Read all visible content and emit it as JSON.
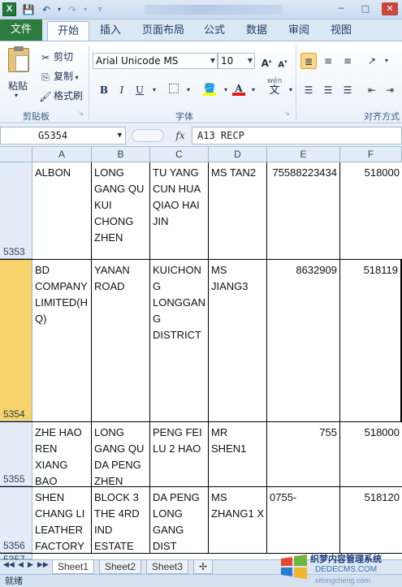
{
  "qat": {
    "app_logo": "X",
    "save_icon": "floppy-icon",
    "undo_icon": "undo-icon",
    "redo_icon": "redo-icon"
  },
  "tabs": [
    {
      "label": "文件"
    },
    {
      "label": "开始"
    },
    {
      "label": "插入"
    },
    {
      "label": "页面布局"
    },
    {
      "label": "公式"
    },
    {
      "label": "数据"
    },
    {
      "label": "审阅"
    },
    {
      "label": "视图"
    }
  ],
  "ribbon": {
    "paste_label": "粘贴",
    "cut_label": "剪切",
    "copy_label": "复制",
    "format_painter_label": "格式刷",
    "clipboard_group": "剪贴板",
    "font_name": "Arial Unicode MS",
    "font_size": "10",
    "bold": "B",
    "italic": "I",
    "underline": "U",
    "font_group": "字体",
    "wen_label": "wén",
    "wen_char": "文",
    "align_group": "对齐方式",
    "grow_font": "A",
    "shrink_font": "A"
  },
  "formula_bar": {
    "name_box": "G5354",
    "fx": "fx",
    "formula": "A13 RECP"
  },
  "columns": [
    "A",
    "B",
    "C",
    "D",
    "E",
    "F"
  ],
  "rows": [
    {
      "num": "5353",
      "selected": false,
      "cells": [
        "ALBON",
        "LONG GANG QU KUI CHONG ZHEN",
        "TU YANG CUN HUA QIAO HAI JIN",
        "MS TAN2",
        "75588223434",
        "518000"
      ]
    },
    {
      "num": "5354",
      "selected": true,
      "cells": [
        "BD COMPANY LIMITED(HQ)",
        "YANAN ROAD",
        "KUICHONG LONGGANG DISTRICT",
        "MS JIANG3",
        "8632909",
        "518119"
      ]
    },
    {
      "num": "5355",
      "selected": false,
      "cells": [
        "ZHE HAO REN XIANG BAO",
        "LONG GANG QU DA PENG ZHEN",
        "PENG FEI LU 2 HAO",
        "MR SHEN1",
        "755",
        "518000"
      ]
    },
    {
      "num": "5356",
      "selected": false,
      "cells": [
        "SHEN CHANG LI LEATHER FACTORY",
        "BLOCK 3 THE 4RD IND ESTATE",
        "DA PENG LONG GANG DIST",
        "MS ZHANG1 X",
        "0755-",
        "518120"
      ]
    },
    {
      "num": "5357",
      "selected": false,
      "cells": [
        "",
        "",
        "",
        "",
        "",
        ""
      ]
    }
  ],
  "sheets": [
    "Sheet1",
    "Sheet2",
    "Sheet3"
  ],
  "status": "就绪",
  "watermark": {
    "line1": "织梦内容管理系统",
    "line2": "DEDECMS.COM",
    "line3": "xitongcheng.com"
  },
  "colors": {
    "file_tab": "#2c7b3f",
    "selected_row_header": "#f7d36b",
    "header_bg": "#e4ecf7"
  }
}
